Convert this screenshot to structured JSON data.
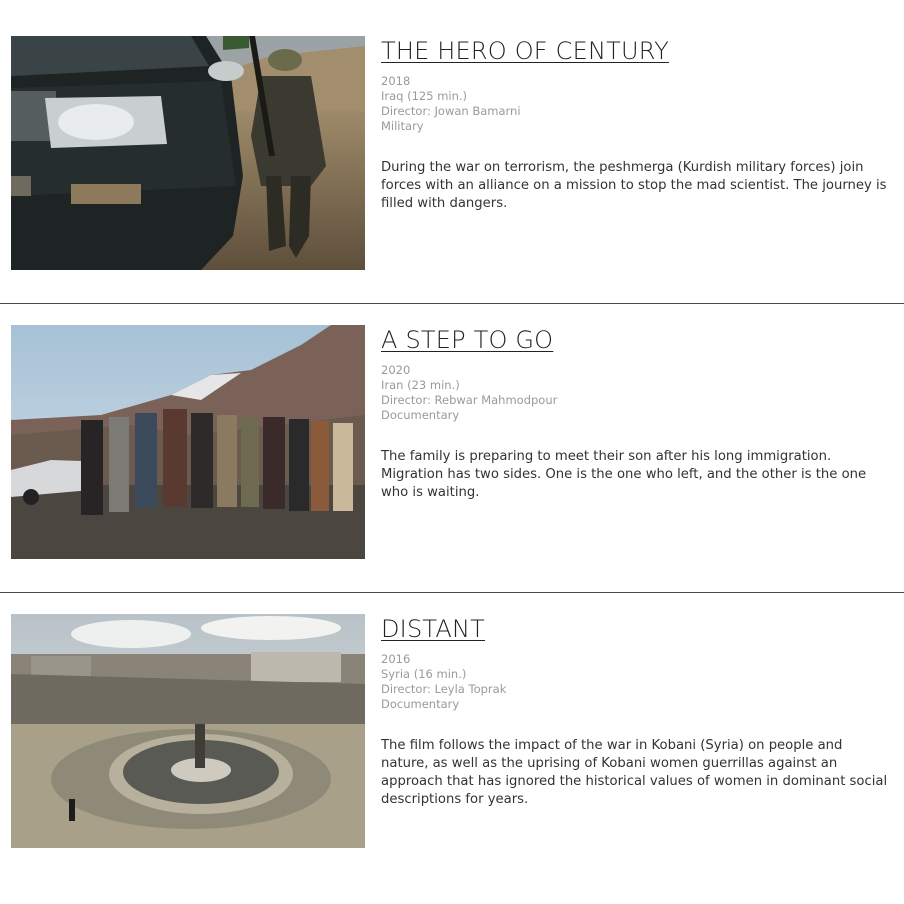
{
  "films": [
    {
      "title": "THE HERO OF CENTURY",
      "year": "2018",
      "country_runtime": "Iraq (125 min.)",
      "director": "Director: Jowan Bamarni",
      "genre": "Military",
      "description": "During the war on terrorism, the peshmerga (Kurdish military forces) join forces with an alliance on a mission to stop the mad scientist. The journey is filled with dangers."
    },
    {
      "title": "A STEP TO GO",
      "year": "2020",
      "country_runtime": "Iran (23 min.)",
      "director": "Director: Rebwar Mahmodpour",
      "genre": "Documentary",
      "description": "The family is preparing to meet their son after his long immigration. Migration has two sides. One is the one who left, and the other is the one who is waiting."
    },
    {
      "title": "DISTANT",
      "year": "2016",
      "country_runtime": "Syria (16 min.)",
      "director": "Director: Leyla Toprak",
      "genre": "Documentary",
      "description": "The film follows the impact of the war in Kobani (Syria) on people and nature, as well as the uprising of Kobani women guerrillas against an approach that has ignored the historical values of women in dominant social descriptions for years."
    }
  ]
}
